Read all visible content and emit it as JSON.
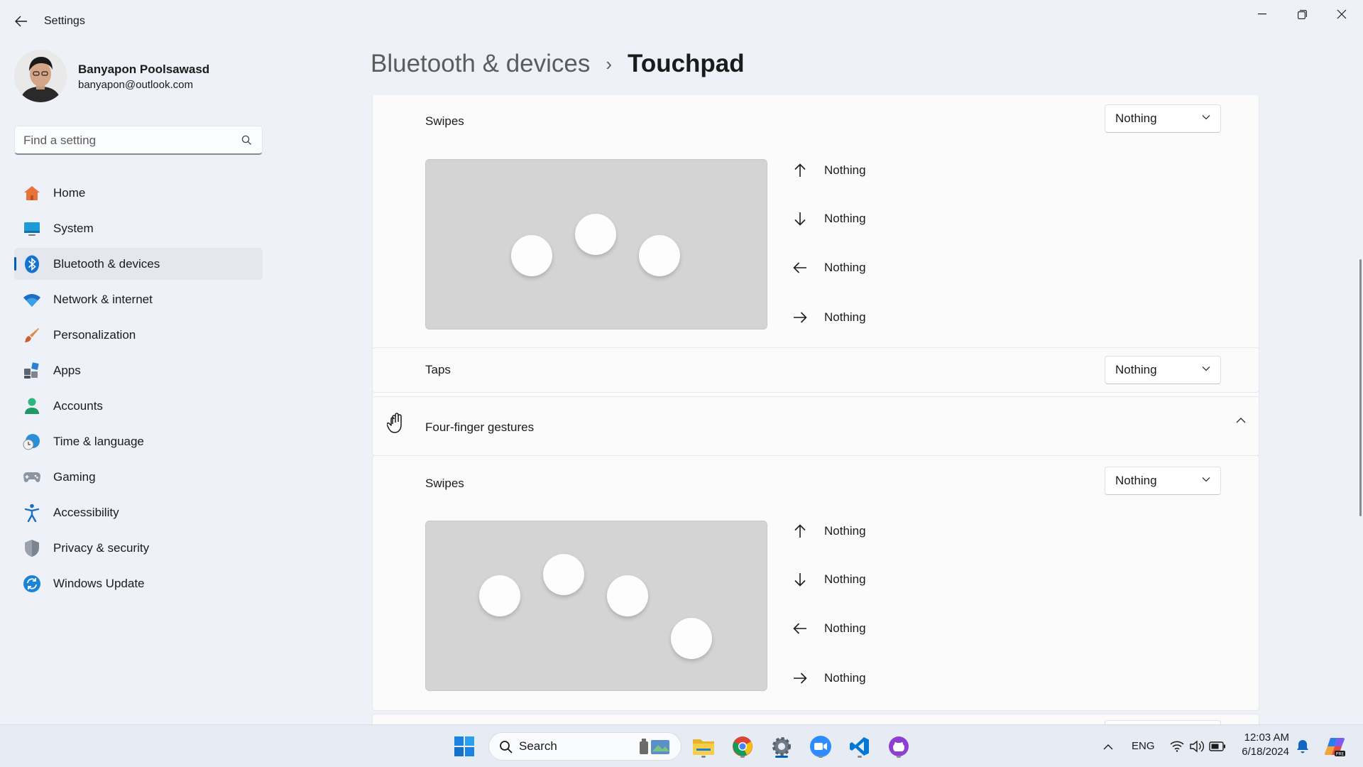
{
  "window": {
    "title": "Settings"
  },
  "profile": {
    "name": "Banyapon Poolsawasd",
    "email": "banyapon@outlook.com"
  },
  "search": {
    "placeholder": "Find a setting"
  },
  "nav": {
    "items": [
      {
        "label": "Home",
        "icon": "home-icon"
      },
      {
        "label": "System",
        "icon": "system-icon"
      },
      {
        "label": "Bluetooth & devices",
        "icon": "bluetooth-icon",
        "active": true
      },
      {
        "label": "Network & internet",
        "icon": "wifi-icon"
      },
      {
        "label": "Personalization",
        "icon": "brush-icon"
      },
      {
        "label": "Apps",
        "icon": "apps-icon"
      },
      {
        "label": "Accounts",
        "icon": "accounts-icon"
      },
      {
        "label": "Time & language",
        "icon": "clock-globe-icon"
      },
      {
        "label": "Gaming",
        "icon": "gamepad-icon"
      },
      {
        "label": "Accessibility",
        "icon": "accessibility-icon"
      },
      {
        "label": "Privacy & security",
        "icon": "shield-icon"
      },
      {
        "label": "Windows Update",
        "icon": "update-icon"
      }
    ]
  },
  "header": {
    "parent": "Bluetooth & devices",
    "separator": "›",
    "current": "Touchpad"
  },
  "three_finger": {
    "swipes_label": "Swipes",
    "swipes_value": "Nothing",
    "directions": [
      {
        "icon": "arrow-up-icon",
        "value": "Nothing"
      },
      {
        "icon": "arrow-down-icon",
        "value": "Nothing"
      },
      {
        "icon": "arrow-left-icon",
        "value": "Nothing"
      },
      {
        "icon": "arrow-right-icon",
        "value": "Nothing"
      }
    ],
    "taps_label": "Taps",
    "taps_value": "Nothing"
  },
  "four_finger": {
    "title": "Four-finger gestures",
    "swipes_label": "Swipes",
    "swipes_value": "Nothing",
    "directions": [
      {
        "icon": "arrow-up-icon",
        "value": "Nothing"
      },
      {
        "icon": "arrow-down-icon",
        "value": "Nothing"
      },
      {
        "icon": "arrow-left-icon",
        "value": "Nothing"
      },
      {
        "icon": "arrow-right-icon",
        "value": "Nothing"
      }
    ]
  },
  "taskbar": {
    "search_label": "Search",
    "apps": [
      "start-icon",
      "file-explorer-icon",
      "chrome-icon",
      "settings-icon",
      "zoom-icon",
      "vscode-icon",
      "github-desktop-icon"
    ]
  },
  "tray": {
    "language": "ENG",
    "time": "12:03 AM",
    "date": "6/18/2024"
  },
  "colors": {
    "accent": "#005fb8",
    "background": "#eef1f8",
    "card": "#fbfbfc"
  }
}
